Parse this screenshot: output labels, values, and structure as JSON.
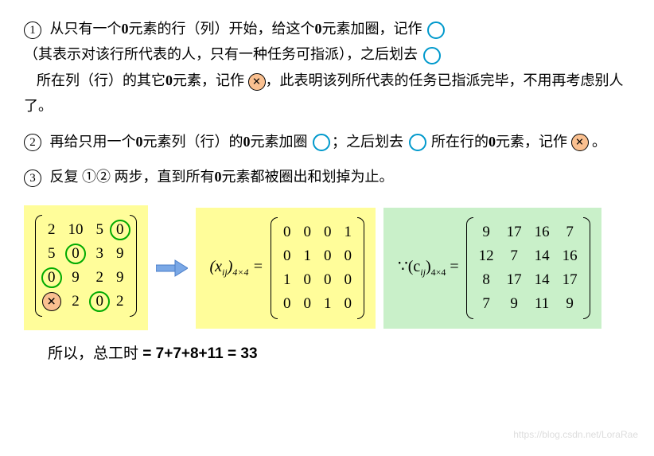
{
  "steps": {
    "s1": {
      "num": "①",
      "line1_a": "从只有一个",
      "line1_b": "0",
      "line1_c": "元素的行（列）开始，给这个",
      "line1_d": "0",
      "line1_e": "元素加圈，记作",
      "line2_a": "（其表示对该行所代表的人，只有一种任务可指派），之后划去",
      "line3_a": "所在列（行）的其它",
      "line3_b": "0",
      "line3_c": "元素，记作",
      "line3_d": "，此表明该列所代表的任务已指派完毕，不用再考虑别人了。"
    },
    "s2": {
      "num": "②",
      "line1_a": "再给只用一个",
      "line1_b": "0",
      "line1_c": "元素列（行）的",
      "line1_d": "0",
      "line1_e": "元素加圈",
      "line1_f": "；之后划去",
      "line1_g": "所在行的",
      "line1_h": "0",
      "line1_i": "元素，记作",
      "line1_j": "。"
    },
    "s3": {
      "num": "③",
      "text": "反复 ①② 两步，直到所有",
      "text_b": "0",
      "text_c": "元素都被圈出和划掉为止。"
    }
  },
  "matrix1": {
    "rows": [
      [
        {
          "v": "2"
        },
        {
          "v": "10"
        },
        {
          "v": "5"
        },
        {
          "v": "0",
          "mark": "circled"
        }
      ],
      [
        {
          "v": "5"
        },
        {
          "v": "0",
          "mark": "circled"
        },
        {
          "v": "3"
        },
        {
          "v": "9"
        }
      ],
      [
        {
          "v": "0",
          "mark": "circled"
        },
        {
          "v": "9"
        },
        {
          "v": "2"
        },
        {
          "v": "9"
        }
      ],
      [
        {
          "v": "",
          "mark": "crossed"
        },
        {
          "v": "2"
        },
        {
          "v": "0",
          "mark": "circled"
        },
        {
          "v": "2"
        }
      ]
    ]
  },
  "matrix2": {
    "label_pre": "(x",
    "label_sub": "ij",
    "label_suf": ")",
    "label_dim": "4×4",
    "label_eq": " =",
    "rows": [
      [
        "0",
        "0",
        "0",
        "1"
      ],
      [
        "0",
        "1",
        "0",
        "0"
      ],
      [
        "1",
        "0",
        "0",
        "0"
      ],
      [
        "0",
        "0",
        "1",
        "0"
      ]
    ]
  },
  "matrix3": {
    "pre": "∵(c",
    "sub": "ij",
    "suf": ")",
    "dim": "4×4",
    "eq": " =",
    "rows": [
      [
        "9",
        "17",
        "16",
        "7"
      ],
      [
        "12",
        "7",
        "14",
        "16"
      ],
      [
        "8",
        "17",
        "14",
        "17"
      ],
      [
        "7",
        "9",
        "11",
        "9"
      ]
    ]
  },
  "result": {
    "label": "所以，总工时",
    "eq": " = 7+7+8+11 = 33"
  },
  "watermark": "https://blog.csdn.net/LoraRae"
}
